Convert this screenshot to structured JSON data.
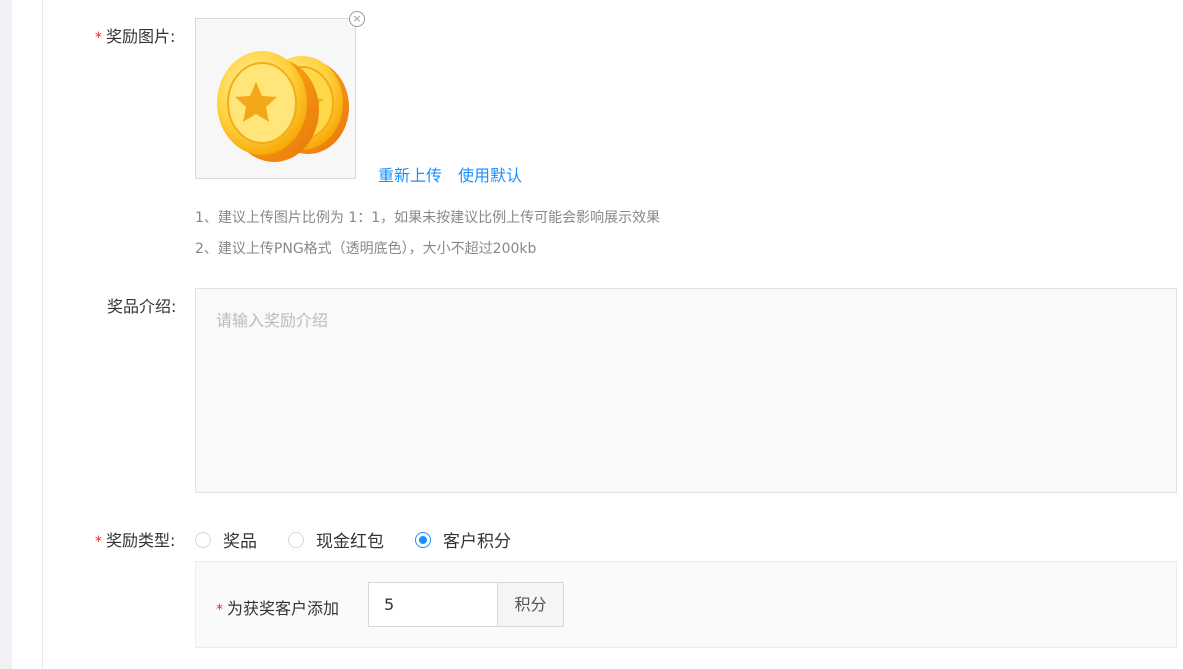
{
  "reward_image": {
    "label": "奖励图片:",
    "remove_glyph": "×",
    "reupload_link": "重新上传",
    "use_default_link": "使用默认",
    "hints": [
      "1、建议上传图片比例为 1：1，如果未按建议比例上传可能会影响展示效果",
      "2、建议上传PNG格式（透明底色），大小不超过200kb"
    ],
    "image_icon": "gold-coins-icon"
  },
  "prize_intro": {
    "label": "奖品介绍:",
    "placeholder": "请输入奖励介绍",
    "value": ""
  },
  "reward_type": {
    "label": "奖励类型:",
    "options": [
      {
        "label": "奖品",
        "checked": false
      },
      {
        "label": "现金红包",
        "checked": false
      },
      {
        "label": "客户积分",
        "checked": true
      }
    ]
  },
  "points": {
    "label": "为获奖客户添加",
    "value": "5",
    "unit": "积分"
  },
  "required_mark": "*",
  "colors": {
    "primary": "#1890ff",
    "required": "#f5222d",
    "coin": "#f7b500"
  }
}
